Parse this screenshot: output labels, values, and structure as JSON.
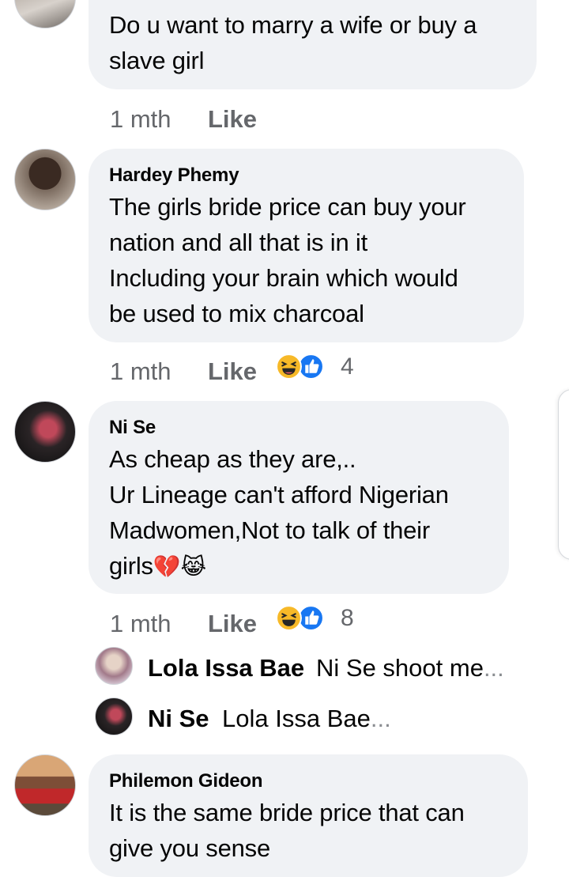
{
  "comments": [
    {
      "author": "",
      "lines": [
        "Do u want to marry a wife or buy a",
        "slave girl"
      ],
      "time": "1 mth",
      "like": "Like",
      "reaction_count": ""
    },
    {
      "author": "Hardey Phemy",
      "lines": [
        "The girls bride price can buy your",
        "nation and all that is in it",
        "Including your brain which would",
        "be used to mix charcoal"
      ],
      "time": "1 mth",
      "like": "Like",
      "reaction_count": "4"
    },
    {
      "author": "Ni Se",
      "lines": [
        "As cheap as they are,..",
        "Ur Lineage can't afford Nigerian",
        "Madwomen,Not to talk of their",
        "girls"
      ],
      "emoji": "💔😹",
      "time": "1 mth",
      "like": "Like",
      "reaction_count": "8"
    },
    {
      "author": "Philemon Gideon",
      "lines": [
        "It is the same bride price that can",
        "give you sense"
      ]
    }
  ],
  "replies": [
    {
      "name": "Lola Issa Bae",
      "text": "Ni Se shoot me",
      "ellipsis": "..."
    },
    {
      "name": "Ni Se",
      "text": "Lola Issa Bae",
      "ellipsis": "..."
    }
  ],
  "colors": {
    "bubble": "#f0f2f5",
    "meta_text": "#65676b",
    "haha_yellow": "#f7b928",
    "like_blue": "#1877f2"
  },
  "icons": [
    "haha-reaction-icon",
    "like-reaction-icon",
    "broken-heart-emoji",
    "crying-laughing-cat-emoji"
  ]
}
